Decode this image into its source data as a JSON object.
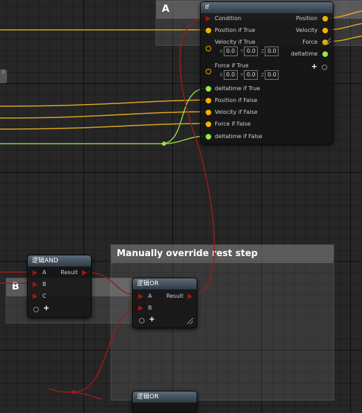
{
  "comments": {
    "a_title": "A",
    "b_title": "B",
    "override_title": "Manually override rest step"
  },
  "if_node": {
    "title": "If",
    "inputs": {
      "condition": "Condition",
      "position_if_true": "Position if True",
      "velocity_if_true": "Velocity if True",
      "force_if_true": "Force if True",
      "deltatime_if_true": "deltatime if True",
      "position_if_false": "Position if False",
      "velocity_if_false": "Velocity if False",
      "force_if_false": "Force if False",
      "deltatime_if_false": "deltatime if False"
    },
    "outputs": {
      "position": "Position",
      "velocity": "Velocity",
      "force": "Force",
      "deltatime": "deltatime"
    },
    "velocity_true": {
      "x_label": "X",
      "x": "0.0",
      "y_label": "Y",
      "y": "0.0",
      "z_label": "Z",
      "z": "0.0"
    },
    "force_true": {
      "x_label": "X",
      "x": "0.0",
      "y_label": "Y",
      "y": "0.0",
      "z_label": "Z",
      "z": "0.0"
    }
  },
  "and_node": {
    "title": "逻辑AND",
    "input_a": "A",
    "input_b": "B",
    "input_c": "C",
    "output": "Result"
  },
  "or_node": {
    "title": "逻辑OR",
    "input_a": "A",
    "input_b": "B",
    "output": "Result"
  },
  "or_node_2": {
    "title": "逻辑OR"
  },
  "add_pin_glyph": "+",
  "side_handle": "⠿",
  "colors": {
    "vector_pin": "#f4b000",
    "float_pin": "#9be54a",
    "bool_pin": "#a01818",
    "bool_wire": "#9a1c1c",
    "vector_wire": "#e0a820",
    "float_wire": "#8fd44a"
  }
}
